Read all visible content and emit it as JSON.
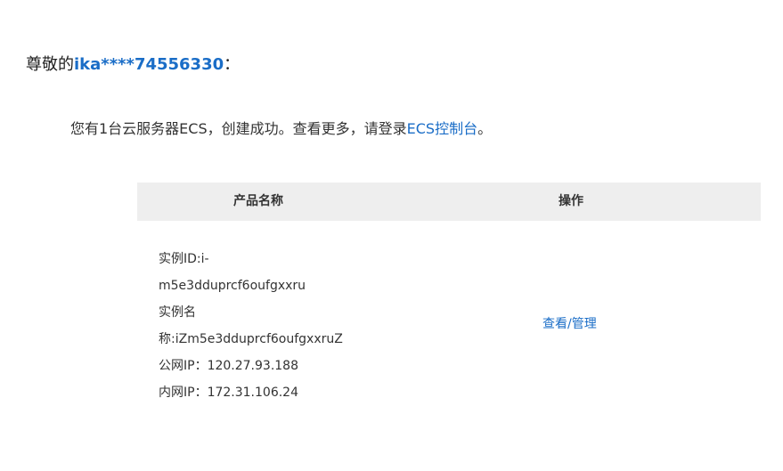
{
  "greeting": {
    "prefix": "尊敬的",
    "username": "ika****74556330",
    "suffix": "："
  },
  "message": {
    "text_before": "您有1台云服务器ECS，创建成功。查看更多，请登录",
    "console_link": "ECS控制台",
    "text_after": "。"
  },
  "table": {
    "headers": {
      "product_name": "产品名称",
      "operation": "操作"
    },
    "row": {
      "instance_id_line1": "实例ID:i-",
      "instance_id_line2": "m5e3dduprcf6oufgxxru",
      "instance_name_line1": "实例名",
      "instance_name_line2": "称:iZm5e3dduprcf6oufgxxruZ",
      "public_ip": "公网IP：120.27.93.188",
      "private_ip": "内网IP：172.31.106.24",
      "action_link": "查看/管理"
    }
  },
  "colors": {
    "link": "#1a6dc7",
    "header_bg": "#eeeeee",
    "text": "#333333"
  }
}
